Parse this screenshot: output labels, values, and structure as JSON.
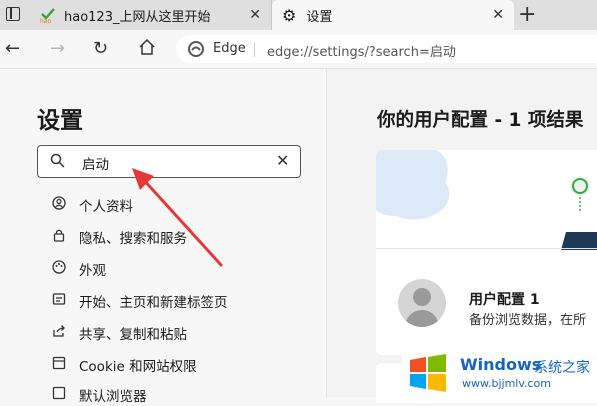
{
  "tabs": [
    {
      "title": "hao123_上网从这里开始",
      "close": "✕"
    },
    {
      "title": "设置",
      "close": "✕"
    }
  ],
  "new_tab_label": "+",
  "address": {
    "brand": "Edge",
    "url": "edge://settings/?search=启动"
  },
  "settings": {
    "title": "设置",
    "search_value": "启动",
    "nav_items": [
      {
        "label": "个人资料",
        "icon": "profile-icon"
      },
      {
        "label": "隐私、搜索和服务",
        "icon": "lock-icon"
      },
      {
        "label": "外观",
        "icon": "appearance-icon"
      },
      {
        "label": "开始、主页和新建标签页",
        "icon": "start-icon"
      },
      {
        "label": "共享、复制和粘贴",
        "icon": "share-icon"
      },
      {
        "label": "Cookie 和网站权限",
        "icon": "cookie-icon"
      },
      {
        "label": "默认浏览器",
        "icon": "browser-icon"
      }
    ]
  },
  "main": {
    "heading": "你的用户配置 - 1 项结果",
    "profile_name": "用户配置 1",
    "profile_desc": "备份浏览数据，在所"
  },
  "watermark": {
    "brand": "Windows",
    "brand_cn": "系统之家",
    "site": "www.bjjmlv.com"
  },
  "colors": {
    "accent": "#0078d4",
    "arrow": "#e53935"
  }
}
